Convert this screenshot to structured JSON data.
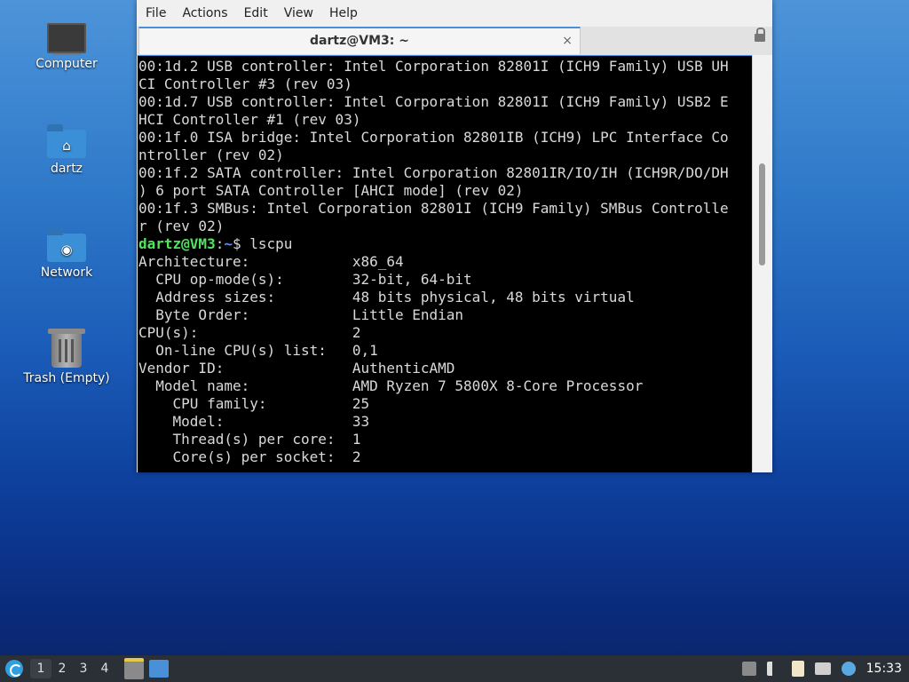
{
  "desktop": {
    "icons": [
      {
        "label": "Computer"
      },
      {
        "label": "dartz"
      },
      {
        "label": "Network"
      },
      {
        "label": "Trash (Empty)"
      }
    ]
  },
  "terminal": {
    "menu": [
      "File",
      "Actions",
      "Edit",
      "View",
      "Help"
    ],
    "tab_title": "dartz@VM3: ~",
    "tab_close": "×",
    "prompt_user": "dartz@VM3",
    "prompt_sep": ":",
    "prompt_path": "~",
    "prompt_symbol": "$ ",
    "command": "lscpu",
    "output_before": [
      "00:1d.2 USB controller: Intel Corporation 82801I (ICH9 Family) USB UH",
      "CI Controller #3 (rev 03)",
      "00:1d.7 USB controller: Intel Corporation 82801I (ICH9 Family) USB2 E",
      "HCI Controller #1 (rev 03)",
      "00:1f.0 ISA bridge: Intel Corporation 82801IB (ICH9) LPC Interface Co",
      "ntroller (rev 02)",
      "00:1f.2 SATA controller: Intel Corporation 82801IR/IO/IH (ICH9R/DO/DH",
      ") 6 port SATA Controller [AHCI mode] (rev 02)",
      "00:1f.3 SMBus: Intel Corporation 82801I (ICH9 Family) SMBus Controlle",
      "r (rev 02)"
    ],
    "output_after": [
      "Architecture:            x86_64",
      "  CPU op-mode(s):        32-bit, 64-bit",
      "  Address sizes:         48 bits physical, 48 bits virtual",
      "  Byte Order:            Little Endian",
      "CPU(s):                  2",
      "  On-line CPU(s) list:   0,1",
      "Vendor ID:               AuthenticAMD",
      "  Model name:            AMD Ryzen 7 5800X 8-Core Processor",
      "    CPU family:          25",
      "    Model:               33",
      "    Thread(s) per core:  1",
      "    Core(s) per socket:  2"
    ]
  },
  "taskbar": {
    "workspaces": [
      "1",
      "2",
      "3",
      "4"
    ],
    "clock": "15:33"
  }
}
